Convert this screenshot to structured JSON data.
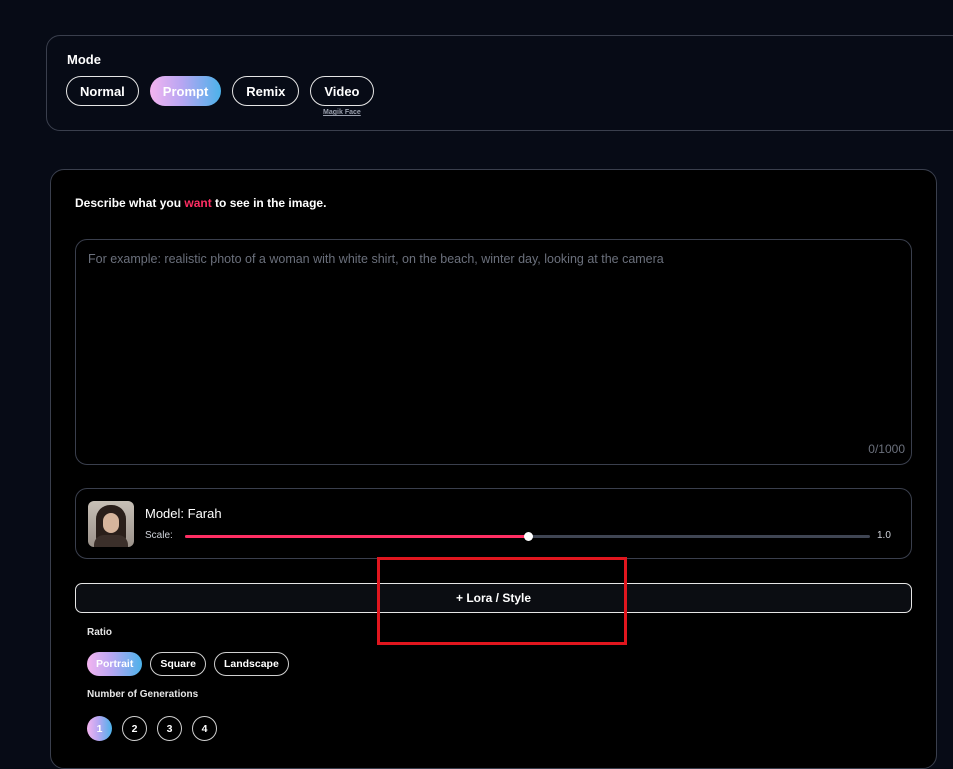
{
  "mode": {
    "title": "Mode",
    "options": [
      {
        "label": "Normal",
        "active": false
      },
      {
        "label": "Prompt",
        "active": true
      },
      {
        "label": "Remix",
        "active": false
      },
      {
        "label": "Video",
        "active": false,
        "sublabel": "Magik Face"
      }
    ]
  },
  "prompt": {
    "label_before": "Describe what you ",
    "label_highlight": "want",
    "label_after": " to see in the image.",
    "placeholder": "For example: realistic photo of a woman with white shirt, on the beach, winter day, looking at the camera",
    "counter": "0/1000"
  },
  "model": {
    "name": "Model: Farah",
    "scale_label": "Scale:",
    "scale_value": "1.0",
    "scale_fraction": 0.5
  },
  "lora_button": "+ Lora / Style",
  "ratio": {
    "title": "Ratio",
    "options": [
      {
        "label": "Portrait",
        "active": true
      },
      {
        "label": "Square",
        "active": false
      },
      {
        "label": "Landscape",
        "active": false
      }
    ]
  },
  "generations": {
    "title": "Number of Generations",
    "options": [
      {
        "label": "1",
        "active": true
      },
      {
        "label": "2",
        "active": false
      },
      {
        "label": "3",
        "active": false
      },
      {
        "label": "4",
        "active": false
      }
    ]
  },
  "colors": {
    "accent": "#ff2e63",
    "background": "#070b16",
    "annotation_box": "#e0161e"
  }
}
